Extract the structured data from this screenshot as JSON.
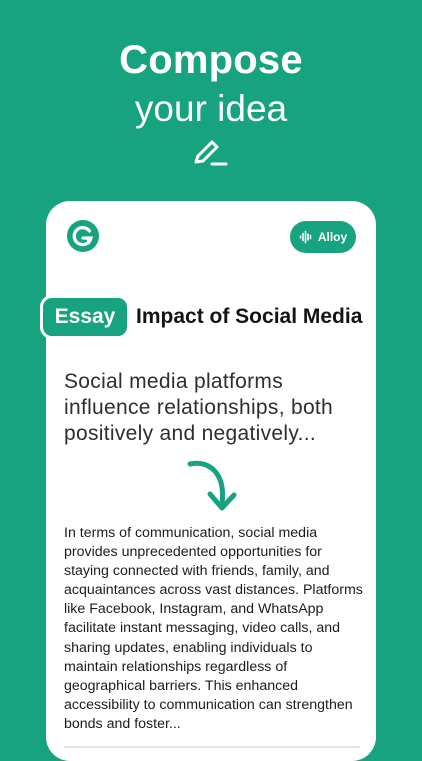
{
  "header": {
    "title": "Compose",
    "subtitle": "your idea"
  },
  "card": {
    "voice_label": "Alloy",
    "tag": "Essay",
    "doc_title": "Impact of Social Media",
    "prompt": "Social media platforms influence relationships, both positively and negatively...",
    "result": "In terms of communication, social media provides unprecedented opportunities for staying connected with friends, family, and acquaintances across vast distances. Platforms like Facebook, Instagram, and WhatsApp facilitate instant messaging, video calls, and sharing updates, enabling individuals to maintain relationships regardless of geographical barriers. This enhanced accessibility to communication can strengthen bonds and foster..."
  },
  "colors": {
    "brand": "#17a37f",
    "background": "#17a37f",
    "card": "#ffffff"
  },
  "icons": [
    "pen-icon",
    "grammarly-logo-icon",
    "soundwave-icon",
    "curved-arrow-down-icon"
  ]
}
